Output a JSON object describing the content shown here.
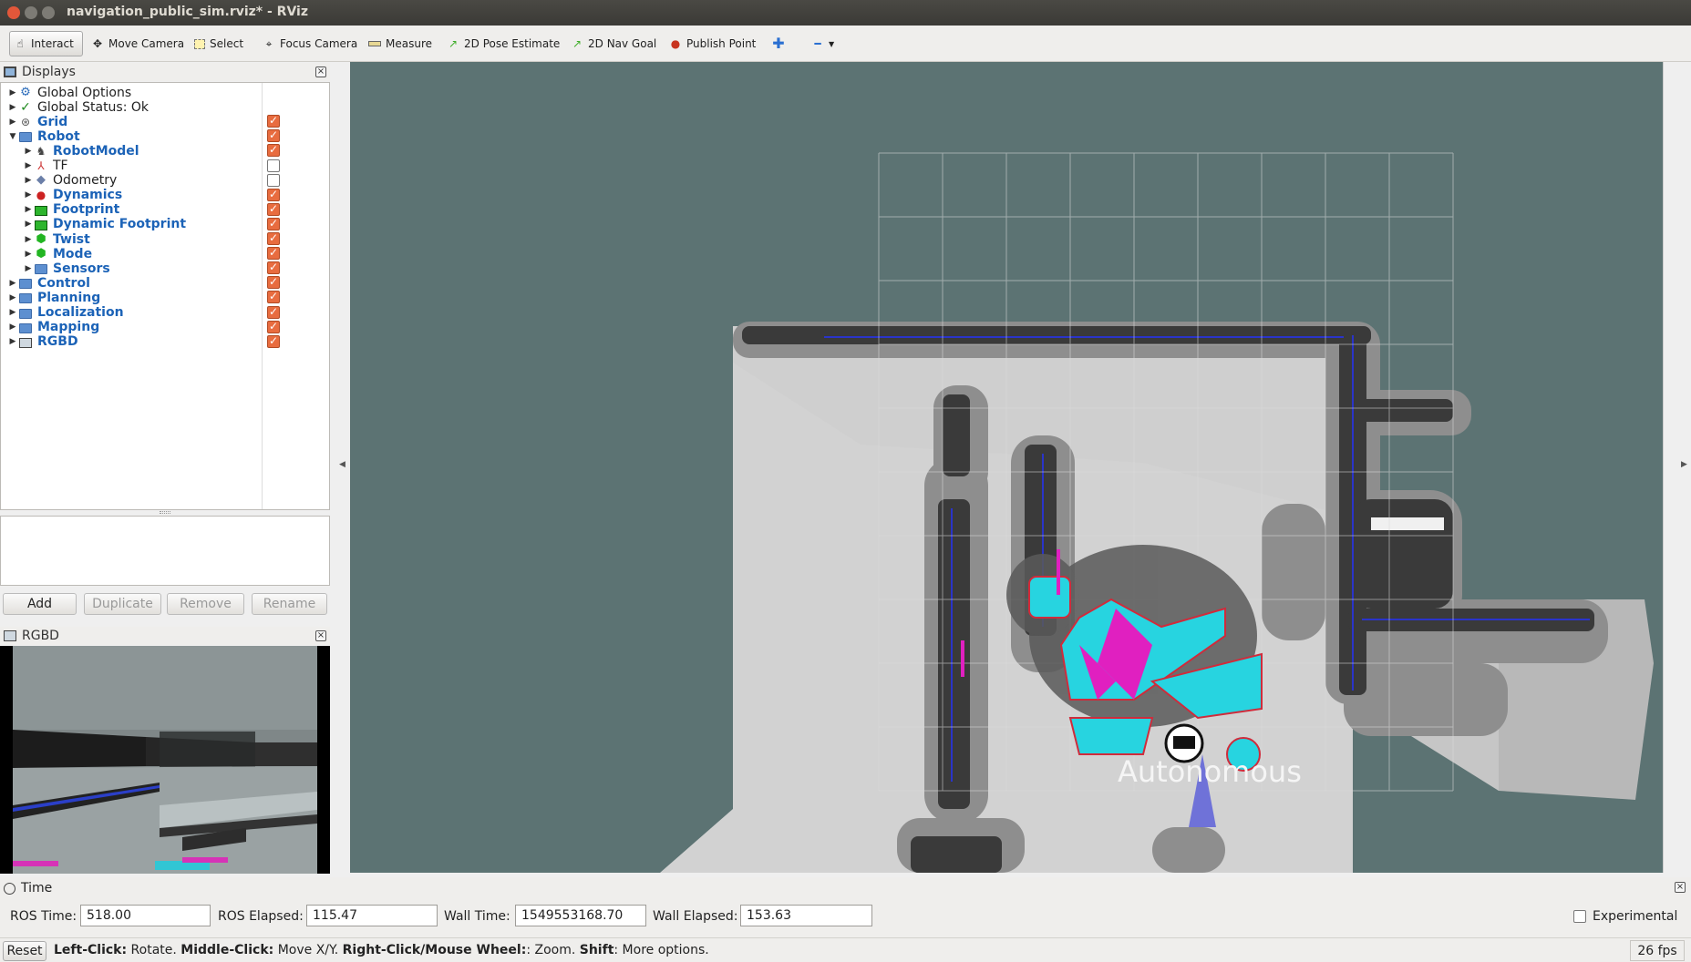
{
  "window": {
    "title": "navigation_public_sim.rviz* - RViz"
  },
  "toolbar": {
    "tools": [
      {
        "label": "Interact",
        "icon": "cursor-icon"
      },
      {
        "label": "Move Camera",
        "icon": "move-camera-icon"
      },
      {
        "label": "Select",
        "icon": "select-icon"
      },
      {
        "label": "Focus Camera",
        "icon": "focus-camera-icon"
      },
      {
        "label": "Measure",
        "icon": "ruler-icon"
      },
      {
        "label": "2D Pose Estimate",
        "icon": "pose-estimate-icon"
      },
      {
        "label": "2D Nav Goal",
        "icon": "nav-goal-icon"
      },
      {
        "label": "Publish Point",
        "icon": "map-pin-icon"
      }
    ],
    "add_tool_icon": "plus-icon",
    "remove_tool_icon": "minus-dropdown-icon"
  },
  "displays": {
    "title": "Displays",
    "items": [
      {
        "label": "Global Options",
        "icon": "gear-icon",
        "bold": false,
        "level": 0,
        "checked": null,
        "expanded": false
      },
      {
        "label": "Global Status: Ok",
        "icon": "check-icon",
        "bold": false,
        "level": 0,
        "checked": null,
        "expanded": false
      },
      {
        "label": "Grid",
        "icon": "grid-icon",
        "bold": true,
        "level": 0,
        "checked": true,
        "expanded": false
      },
      {
        "label": "Robot",
        "icon": "folder-icon",
        "bold": true,
        "level": 0,
        "checked": true,
        "expanded": true
      },
      {
        "label": "RobotModel",
        "icon": "robot-model-icon",
        "bold": true,
        "level": 1,
        "checked": true,
        "expanded": false
      },
      {
        "label": "TF",
        "icon": "axes-icon",
        "bold": false,
        "level": 1,
        "checked": false,
        "expanded": false
      },
      {
        "label": "Odometry",
        "icon": "diamond-icon",
        "bold": false,
        "level": 1,
        "checked": false,
        "expanded": false
      },
      {
        "label": "Dynamics",
        "icon": "dots-icon",
        "bold": true,
        "level": 1,
        "checked": true,
        "expanded": false
      },
      {
        "label": "Footprint",
        "icon": "polygon-icon",
        "bold": true,
        "level": 1,
        "checked": true,
        "expanded": false
      },
      {
        "label": "Dynamic Footprint",
        "icon": "polygon-icon",
        "bold": true,
        "level": 1,
        "checked": true,
        "expanded": false
      },
      {
        "label": "Twist",
        "icon": "green-cube-icon",
        "bold": true,
        "level": 1,
        "checked": true,
        "expanded": false
      },
      {
        "label": "Mode",
        "icon": "green-cube-icon",
        "bold": true,
        "level": 1,
        "checked": true,
        "expanded": false
      },
      {
        "label": "Sensors",
        "icon": "folder-icon",
        "bold": true,
        "level": 1,
        "checked": true,
        "expanded": false
      },
      {
        "label": "Control",
        "icon": "folder-icon",
        "bold": true,
        "level": 0,
        "checked": true,
        "expanded": false
      },
      {
        "label": "Planning",
        "icon": "folder-icon",
        "bold": true,
        "level": 0,
        "checked": true,
        "expanded": false
      },
      {
        "label": "Localization",
        "icon": "folder-icon",
        "bold": true,
        "level": 0,
        "checked": true,
        "expanded": false
      },
      {
        "label": "Mapping",
        "icon": "folder-icon",
        "bold": true,
        "level": 0,
        "checked": true,
        "expanded": false
      },
      {
        "label": "RGBD",
        "icon": "camera-display-icon",
        "bold": true,
        "level": 0,
        "checked": true,
        "expanded": false
      }
    ],
    "buttons": {
      "add": "Add",
      "duplicate": "Duplicate",
      "remove": "Remove",
      "rename": "Rename"
    }
  },
  "rgbd_panel": {
    "title": "RGBD"
  },
  "viewport": {
    "robot_mode_label": "Autonomous"
  },
  "time_panel": {
    "title": "Time",
    "ros_time_label": "ROS Time:",
    "ros_time_value": "518.00",
    "ros_elapsed_label": "ROS Elapsed:",
    "ros_elapsed_value": "115.47",
    "wall_time_label": "Wall Time:",
    "wall_time_value": "1549553168.70",
    "wall_elapsed_label": "Wall Elapsed:",
    "wall_elapsed_value": "153.63",
    "experimental_label": "Experimental",
    "experimental_checked": false
  },
  "status_bar": {
    "reset_label": "Reset",
    "hint_parts": [
      {
        "text": "Left-Click:",
        "bold": true
      },
      {
        "text": " Rotate. ",
        "bold": false
      },
      {
        "text": "Middle-Click:",
        "bold": true
      },
      {
        "text": " Move X/Y. ",
        "bold": false
      },
      {
        "text": "Right-Click/Mouse Wheel:",
        "bold": true
      },
      {
        "text": ": Zoom. ",
        "bold": false
      },
      {
        "text": "Shift",
        "bold": true
      },
      {
        "text": ": More options.",
        "bold": false
      }
    ],
    "fps": "26 fps"
  },
  "colors": {
    "accent_checkbox": "#e86c3f",
    "bold_label": "#1c63b7",
    "viewport_bg": "#5c7373",
    "costmap_cyan": "#27d4e0",
    "costmap_magenta": "#e020c0"
  }
}
